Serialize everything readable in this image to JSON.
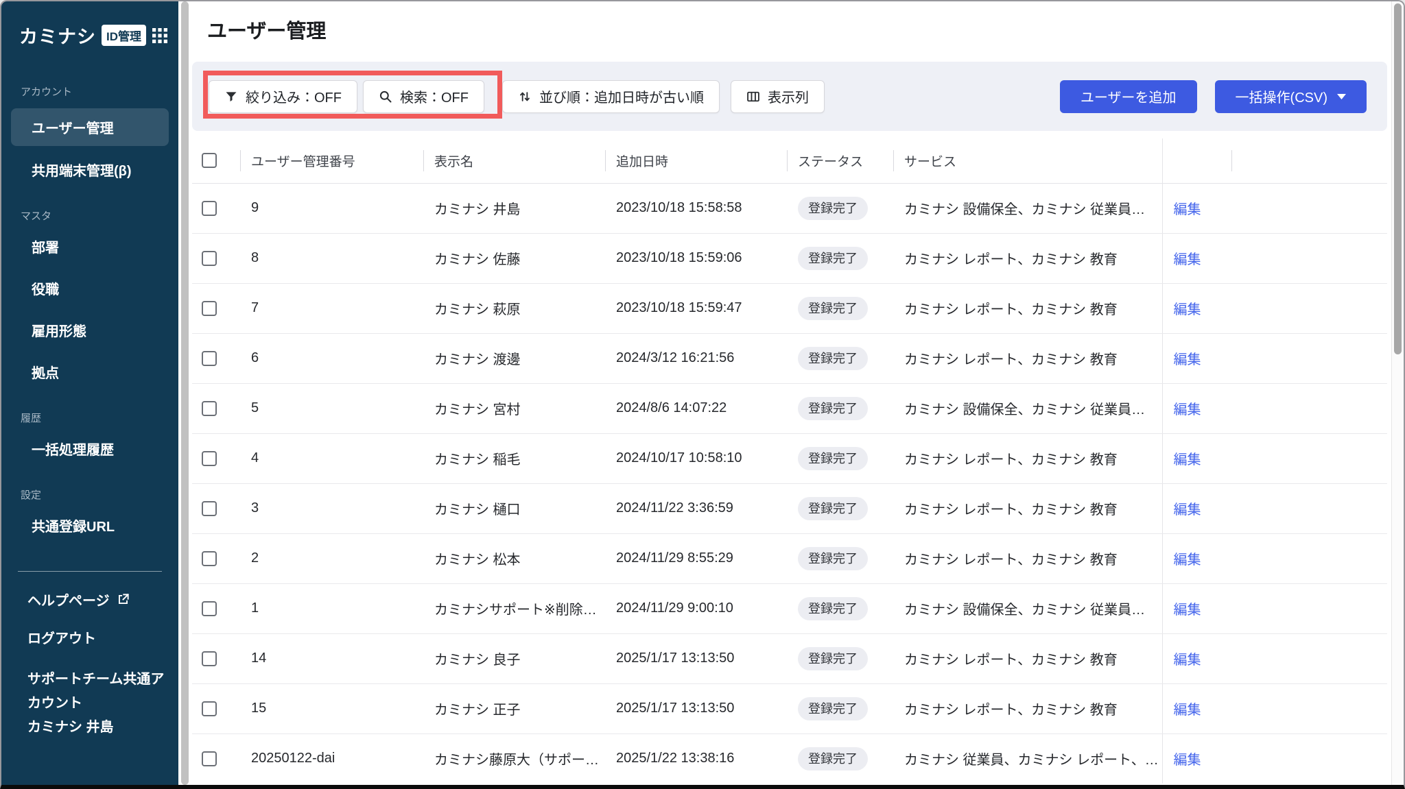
{
  "app": {
    "brand": "カミナシ",
    "brand_badge": "ID管理"
  },
  "sidebar": {
    "sections": [
      {
        "label": "アカウント",
        "items": [
          {
            "label": "ユーザー管理",
            "active": true
          },
          {
            "label": "共用端末管理(β)",
            "active": false
          }
        ]
      },
      {
        "label": "マスタ",
        "items": [
          {
            "label": "部署"
          },
          {
            "label": "役職"
          },
          {
            "label": "雇用形態"
          },
          {
            "label": "拠点"
          }
        ]
      },
      {
        "label": "履歴",
        "items": [
          {
            "label": "一括処理履歴"
          }
        ]
      },
      {
        "label": "設定",
        "items": [
          {
            "label": "共通登録URL"
          }
        ]
      }
    ],
    "footer": {
      "help": "ヘルプページ",
      "logout": "ログアウト",
      "account_name": "サポートチーム共通アカウント",
      "user_name": "カミナシ 井島"
    }
  },
  "header": {
    "title": "ユーザー管理"
  },
  "toolbar": {
    "filter_label": "絞り込み：OFF",
    "search_label": "検索：OFF",
    "sort_label": "並び順：追加日時が古い順",
    "columns_label": "表示列",
    "add_user_label": "ユーザーを追加",
    "bulk_label": "一括操作(CSV)"
  },
  "table": {
    "headers": [
      "ユーザー管理番号",
      "表示名",
      "追加日時",
      "ステータス",
      "サービス"
    ],
    "edit_label": "編集",
    "rows": [
      {
        "id": "9",
        "name": "カミナシ 井島",
        "date": "2023/10/18 15:58:58",
        "status": "登録完了",
        "services": "カミナシ 設備保全、カミナシ 従業員…"
      },
      {
        "id": "8",
        "name": "カミナシ 佐藤",
        "date": "2023/10/18 15:59:06",
        "status": "登録完了",
        "services": "カミナシ レポート、カミナシ 教育"
      },
      {
        "id": "7",
        "name": "カミナシ 萩原",
        "date": "2023/10/18 15:59:47",
        "status": "登録完了",
        "services": "カミナシ レポート、カミナシ 教育"
      },
      {
        "id": "6",
        "name": "カミナシ 渡邊",
        "date": "2024/3/12 16:21:56",
        "status": "登録完了",
        "services": "カミナシ レポート、カミナシ 教育"
      },
      {
        "id": "5",
        "name": "カミナシ 宮村",
        "date": "2024/8/6 14:07:22",
        "status": "登録完了",
        "services": "カミナシ 設備保全、カミナシ 従業員…"
      },
      {
        "id": "4",
        "name": "カミナシ 稲毛",
        "date": "2024/10/17 10:58:10",
        "status": "登録完了",
        "services": "カミナシ レポート、カミナシ 教育"
      },
      {
        "id": "3",
        "name": "カミナシ 樋口",
        "date": "2024/11/22 3:36:59",
        "status": "登録完了",
        "services": "カミナシ レポート、カミナシ 教育"
      },
      {
        "id": "2",
        "name": "カミナシ 松本",
        "date": "2024/11/29 8:55:29",
        "status": "登録完了",
        "services": "カミナシ レポート、カミナシ 教育"
      },
      {
        "id": "1",
        "name": "カミナシサポート※削除…",
        "date": "2024/11/29 9:00:10",
        "status": "登録完了",
        "services": "カミナシ 設備保全、カミナシ 従業員…"
      },
      {
        "id": "14",
        "name": "カミナシ 良子",
        "date": "2025/1/17 13:13:50",
        "status": "登録完了",
        "services": "カミナシ レポート、カミナシ 教育"
      },
      {
        "id": "15",
        "name": "カミナシ 正子",
        "date": "2025/1/17 13:13:50",
        "status": "登録完了",
        "services": "カミナシ レポート、カミナシ 教育"
      },
      {
        "id": "20250122-dai",
        "name": "カミナシ藤原大（サポー…",
        "date": "2025/1/22 13:38:16",
        "status": "登録完了",
        "services": "カミナシ 従業員、カミナシ レポート、…"
      }
    ]
  },
  "colors": {
    "sidebar_navy": "#113A54",
    "primary_blue": "#3D5AE1",
    "link_blue": "#4263EB",
    "annotation_red": "#F15B5B",
    "toolbar_bg": "#EEF0F6",
    "badge_bg": "#ECEDF2"
  }
}
